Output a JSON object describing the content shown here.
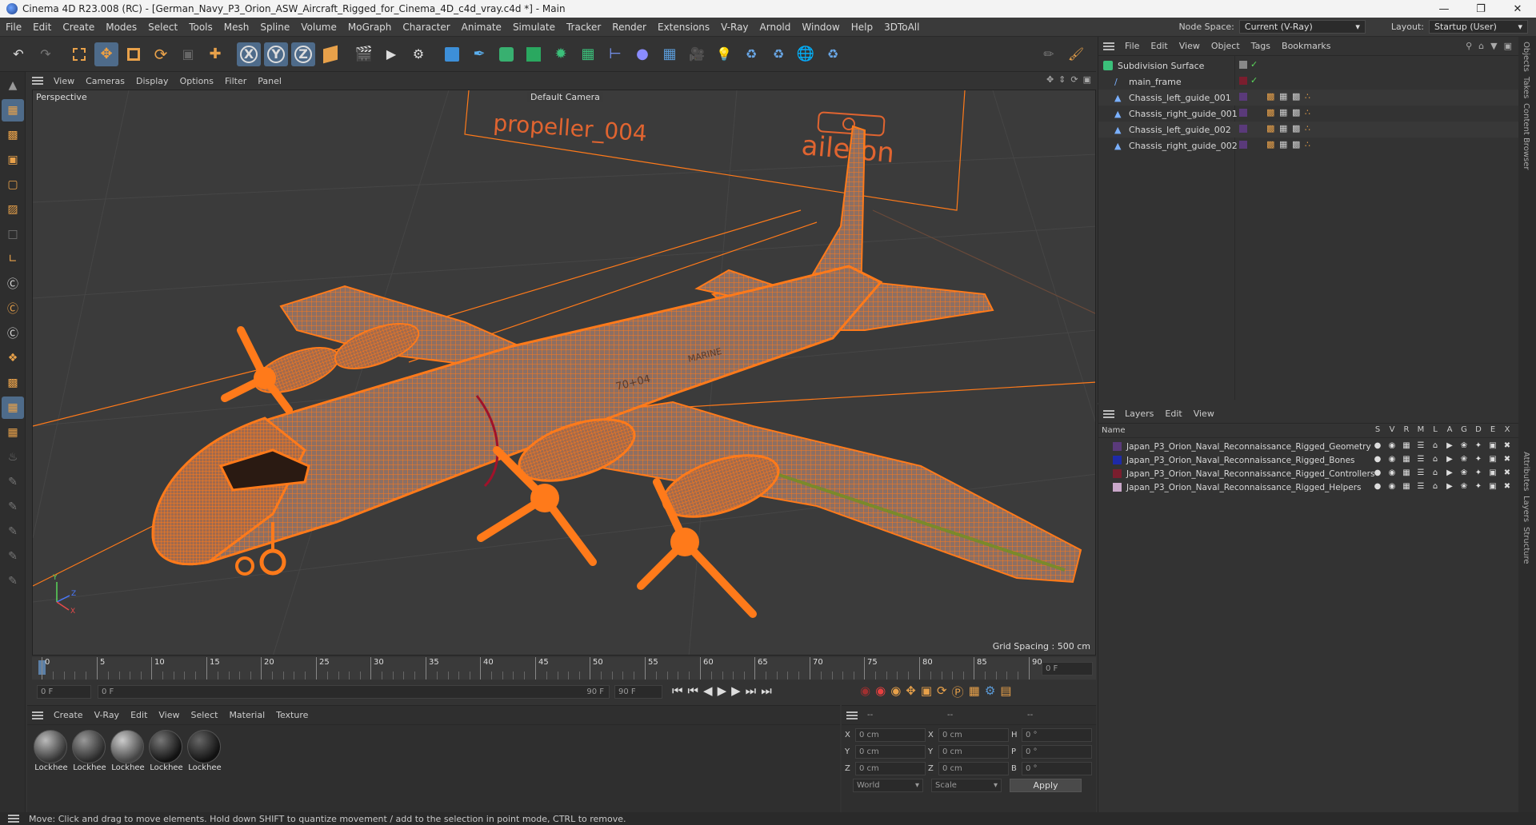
{
  "window": {
    "title": "Cinema 4D R23.008 (RC) - [German_Navy_P3_Orion_ASW_Aircraft_Rigged_for_Cinema_4D_c4d_vray.c4d *] - Main"
  },
  "menubar": {
    "items": [
      "File",
      "Edit",
      "Create",
      "Modes",
      "Select",
      "Tools",
      "Mesh",
      "Spline",
      "Volume",
      "MoGraph",
      "Character",
      "Animate",
      "Simulate",
      "Tracker",
      "Render",
      "Extensions",
      "V-Ray",
      "Arnold",
      "Window",
      "Help",
      "3DToAll"
    ],
    "node_space_label": "Node Space:",
    "node_space_value": "Current (V-Ray)",
    "layout_label": "Layout:",
    "layout_value": "Startup (User)"
  },
  "viewport": {
    "menu": [
      "View",
      "Cameras",
      "Display",
      "Options",
      "Filter",
      "Panel"
    ],
    "label": "Perspective",
    "camera": "Default Camera",
    "grid_spacing": "Grid Spacing : 500 cm",
    "overlay_text_1": "propeller_004",
    "overlay_text_2": "aileron",
    "fuselage_marking": "MARINE",
    "fuselage_number": "70+04"
  },
  "timeline": {
    "ticks": [
      "0",
      "5",
      "10",
      "15",
      "20",
      "25",
      "30",
      "35",
      "40",
      "45",
      "50",
      "55",
      "60",
      "65",
      "70",
      "75",
      "80",
      "85",
      "90"
    ],
    "current_frame_right": "0 F",
    "start_field": "0 F",
    "range_start": "0 F",
    "range_end": "90 F",
    "end_field": "90 F"
  },
  "material_manager": {
    "menu": [
      "Create",
      "V-Ray",
      "Edit",
      "View",
      "Select",
      "Material",
      "Texture"
    ],
    "materials": [
      "Lockhee",
      "Lockhee",
      "Lockhee",
      "Lockhee",
      "Lockhee"
    ]
  },
  "coordinates": {
    "col_headers": [
      "--",
      "--",
      "--"
    ],
    "rows": [
      {
        "axis": "X",
        "pos": "0 cm",
        "axis2": "X",
        "size": "0 cm",
        "axis3": "H",
        "rot": "0 °"
      },
      {
        "axis": "Y",
        "pos": "0 cm",
        "axis2": "Y",
        "size": "0 cm",
        "axis3": "P",
        "rot": "0 °"
      },
      {
        "axis": "Z",
        "pos": "0 cm",
        "axis2": "Z",
        "size": "0 cm",
        "axis3": "B",
        "rot": "0 °"
      }
    ],
    "mode_world": "World",
    "mode_scale": "Scale",
    "apply_label": "Apply"
  },
  "object_manager": {
    "menu": [
      "File",
      "Edit",
      "View",
      "Object",
      "Tags",
      "Bookmarks"
    ],
    "objects": [
      {
        "name": "Subdivision Surface",
        "indent": 0
      },
      {
        "name": "main_frame",
        "indent": 1
      },
      {
        "name": "Chassis_left_guide_001",
        "indent": 1
      },
      {
        "name": "Chassis_right_guide_001",
        "indent": 1
      },
      {
        "name": "Chassis_left_guide_002",
        "indent": 1
      },
      {
        "name": "Chassis_right_guide_002",
        "indent": 1
      }
    ]
  },
  "layer_manager": {
    "menu": [
      "Layers",
      "Edit",
      "View"
    ],
    "name_header": "Name",
    "flag_headers": [
      "S",
      "V",
      "R",
      "M",
      "L",
      "A",
      "G",
      "D",
      "E",
      "X"
    ],
    "layers": [
      {
        "name": "Japan_P3_Orion_Naval_Reconnaissance_Rigged_Geometry",
        "color": "#5a3a7a"
      },
      {
        "name": "Japan_P3_Orion_Naval_Reconnaissance_Rigged_Bones",
        "color": "#1e2aa8"
      },
      {
        "name": "Japan_P3_Orion_Naval_Reconnaissance_Rigged_Controllers",
        "color": "#7a1e2e"
      },
      {
        "name": "Japan_P3_Orion_Naval_Reconnaissance_Rigged_Helpers",
        "color": "#c9a7c9"
      }
    ]
  },
  "side_tabs": [
    "Objects",
    "Takes",
    "Content Browser",
    "Attributes",
    "Layers",
    "Structure"
  ],
  "status": {
    "text": "Move: Click and drag to move elements. Hold down SHIFT to quantize movement / add to the selection in point mode, CTRL to remove."
  },
  "colors": {
    "wire": "#ff7a1a",
    "accent_blue": "#4e6b8a",
    "orange_icon": "#e8a14a"
  }
}
